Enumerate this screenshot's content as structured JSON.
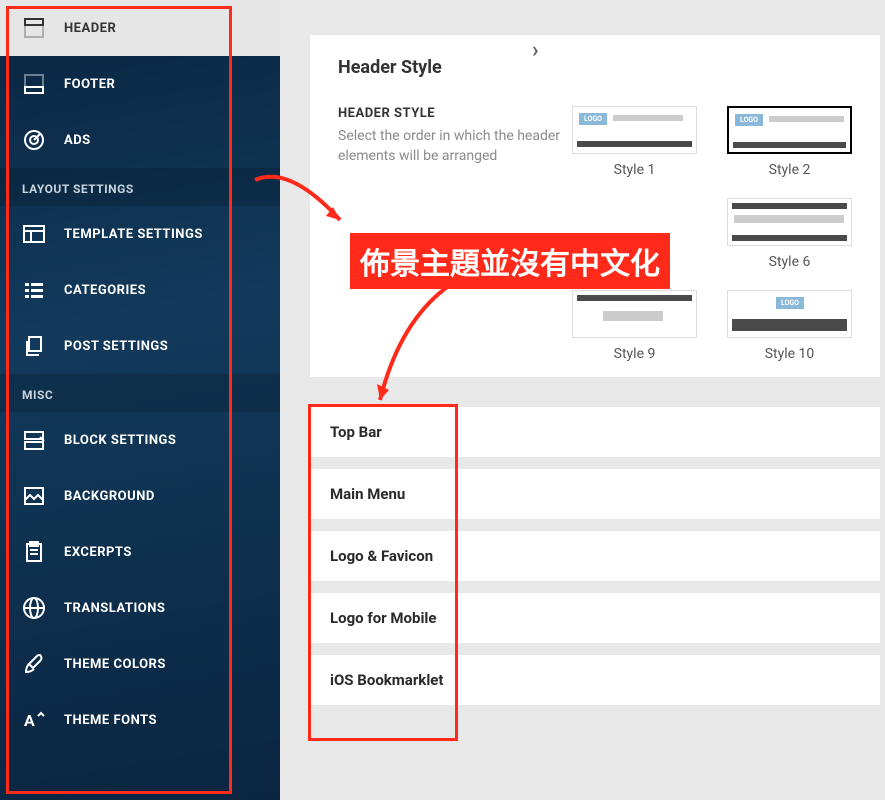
{
  "sidebar": {
    "items": [
      {
        "label": "HEADER",
        "icon": "header-icon",
        "active": true
      },
      {
        "label": "FOOTER",
        "icon": "footer-icon"
      },
      {
        "label": "ADS",
        "icon": "target-icon"
      }
    ],
    "sections": [
      {
        "title": "LAYOUT SETTINGS",
        "items": [
          {
            "label": "TEMPLATE SETTINGS",
            "icon": "template-icon"
          },
          {
            "label": "CATEGORIES",
            "icon": "list-icon"
          },
          {
            "label": "POST SETTINGS",
            "icon": "copy-icon"
          }
        ]
      },
      {
        "title": "MISC",
        "items": [
          {
            "label": "BLOCK SETTINGS",
            "icon": "blocks-icon"
          },
          {
            "label": "BACKGROUND",
            "icon": "image-icon"
          },
          {
            "label": "EXCERPTS",
            "icon": "clipboard-icon"
          },
          {
            "label": "TRANSLATIONS",
            "icon": "globe-icon"
          },
          {
            "label": "THEME COLORS",
            "icon": "brush-icon"
          },
          {
            "label": "THEME FONTS",
            "icon": "font-icon"
          }
        ]
      }
    ]
  },
  "panel": {
    "title": "Header Style",
    "sub_title": "HEADER STYLE",
    "description": "Select the order in which the header elements will be arranged",
    "styles": [
      {
        "label": "Style 1"
      },
      {
        "label": "Style 2",
        "selected": true
      },
      {
        "label": "Style 6"
      },
      {
        "label": "Style 9"
      },
      {
        "label": "Style 10"
      }
    ]
  },
  "accordion": [
    "Top Bar",
    "Main Menu",
    "Logo & Favicon",
    "Logo for Mobile",
    "iOS Bookmarklet"
  ],
  "annotation": {
    "label": "佈景主題並沒有中文化"
  }
}
